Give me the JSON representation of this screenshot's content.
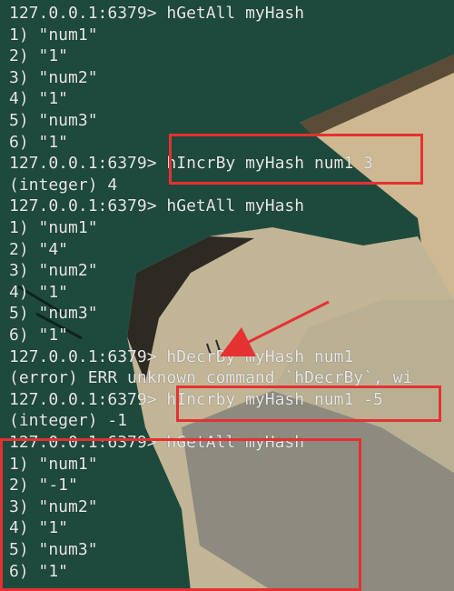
{
  "colors": {
    "terminal_bg": "#1f4a3e",
    "text": "#e8e8e8",
    "highlight": "#e53131"
  },
  "terminal": {
    "lines": [
      "127.0.0.1:6379> hGetAll myHash",
      "1) \"num1\"",
      "2) \"1\"",
      "3) \"num2\"",
      "4) \"1\"",
      "5) \"num3\"",
      "6) \"1\"",
      "127.0.0.1:6379> hIncrBy myHash num1 3",
      "(integer) 4",
      "127.0.0.1:6379> hGetAll myHash",
      "1) \"num1\"",
      "2) \"4\"",
      "3) \"num2\"",
      "4) \"1\"",
      "5) \"num3\"",
      "6) \"1\"",
      "127.0.0.1:6379> hDecrBy myHash num1",
      "(error) ERR unknown command `hDecrBy`, wi",
      "127.0.0.1:6379> hIncrby myHash num1 -5",
      "(integer) -1",
      "127.0.0.1:6379> hGetAll myHash",
      "1) \"num1\"",
      "2) \"-1\"",
      "3) \"num2\"",
      "4) \"1\"",
      "5) \"num3\"",
      "6) \"1\""
    ]
  }
}
